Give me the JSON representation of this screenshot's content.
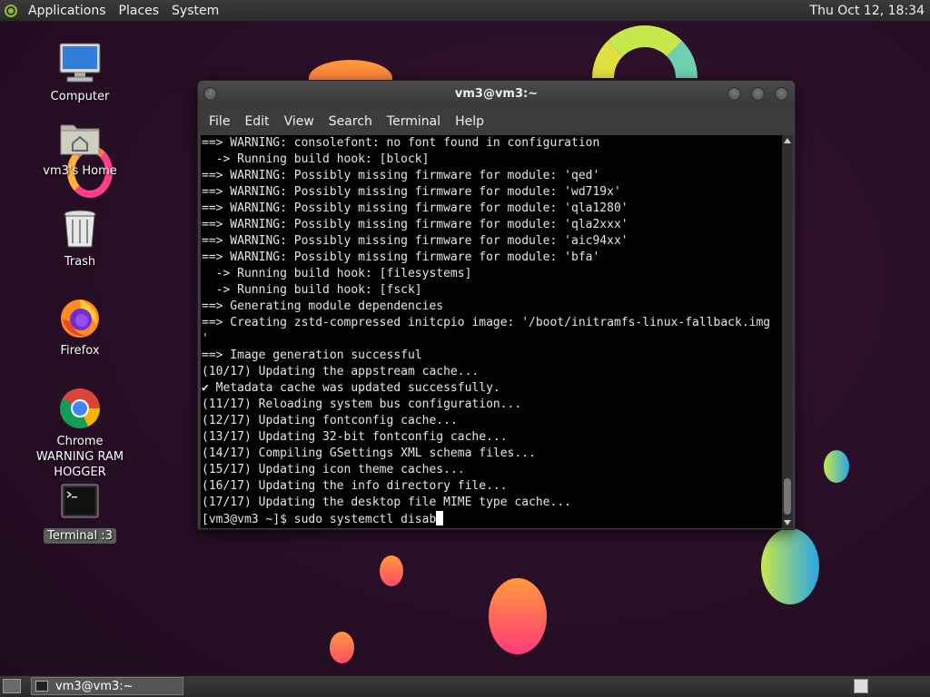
{
  "top_panel": {
    "menus": [
      "Applications",
      "Places",
      "System"
    ],
    "clock": "Thu Oct 12, 18:34"
  },
  "desktop_icons": [
    {
      "label": "Computer",
      "icon": "computer-icon"
    },
    {
      "label": "vm3's Home",
      "icon": "home-folder-icon"
    },
    {
      "label": "Trash",
      "icon": "trash-icon"
    },
    {
      "label": "Firefox",
      "icon": "firefox-icon"
    },
    {
      "label": "Chrome WARNING RAM HOGGER",
      "icon": "chrome-icon"
    },
    {
      "label": "Terminal :3",
      "icon": "terminal-icon"
    }
  ],
  "window": {
    "title": "vm3@vm3:~",
    "menu": [
      "File",
      "Edit",
      "View",
      "Search",
      "Terminal",
      "Help"
    ]
  },
  "terminal": {
    "lines": [
      "==> WARNING: consolefont: no font found in configuration",
      "  -> Running build hook: [block]",
      "==> WARNING: Possibly missing firmware for module: 'qed'",
      "==> WARNING: Possibly missing firmware for module: 'wd719x'",
      "==> WARNING: Possibly missing firmware for module: 'qla1280'",
      "==> WARNING: Possibly missing firmware for module: 'qla2xxx'",
      "==> WARNING: Possibly missing firmware for module: 'aic94xx'",
      "==> WARNING: Possibly missing firmware for module: 'bfa'",
      "  -> Running build hook: [filesystems]",
      "  -> Running build hook: [fsck]",
      "==> Generating module dependencies",
      "==> Creating zstd-compressed initcpio image: '/boot/initramfs-linux-fallback.img",
      "'",
      "==> Image generation successful",
      "(10/17) Updating the appstream cache...",
      "✔ Metadata cache was updated successfully.",
      "(11/17) Reloading system bus configuration...",
      "(12/17) Updating fontconfig cache...",
      "(13/17) Updating 32-bit fontconfig cache...",
      "(14/17) Compiling GSettings XML schema files...",
      "(15/17) Updating icon theme caches...",
      "(16/17) Updating the info directory file...",
      "(17/17) Updating the desktop file MIME type cache..."
    ],
    "prompt": "[vm3@vm3 ~]$ sudo systemctl disab"
  },
  "taskbar": {
    "task_label": "vm3@vm3:~"
  }
}
